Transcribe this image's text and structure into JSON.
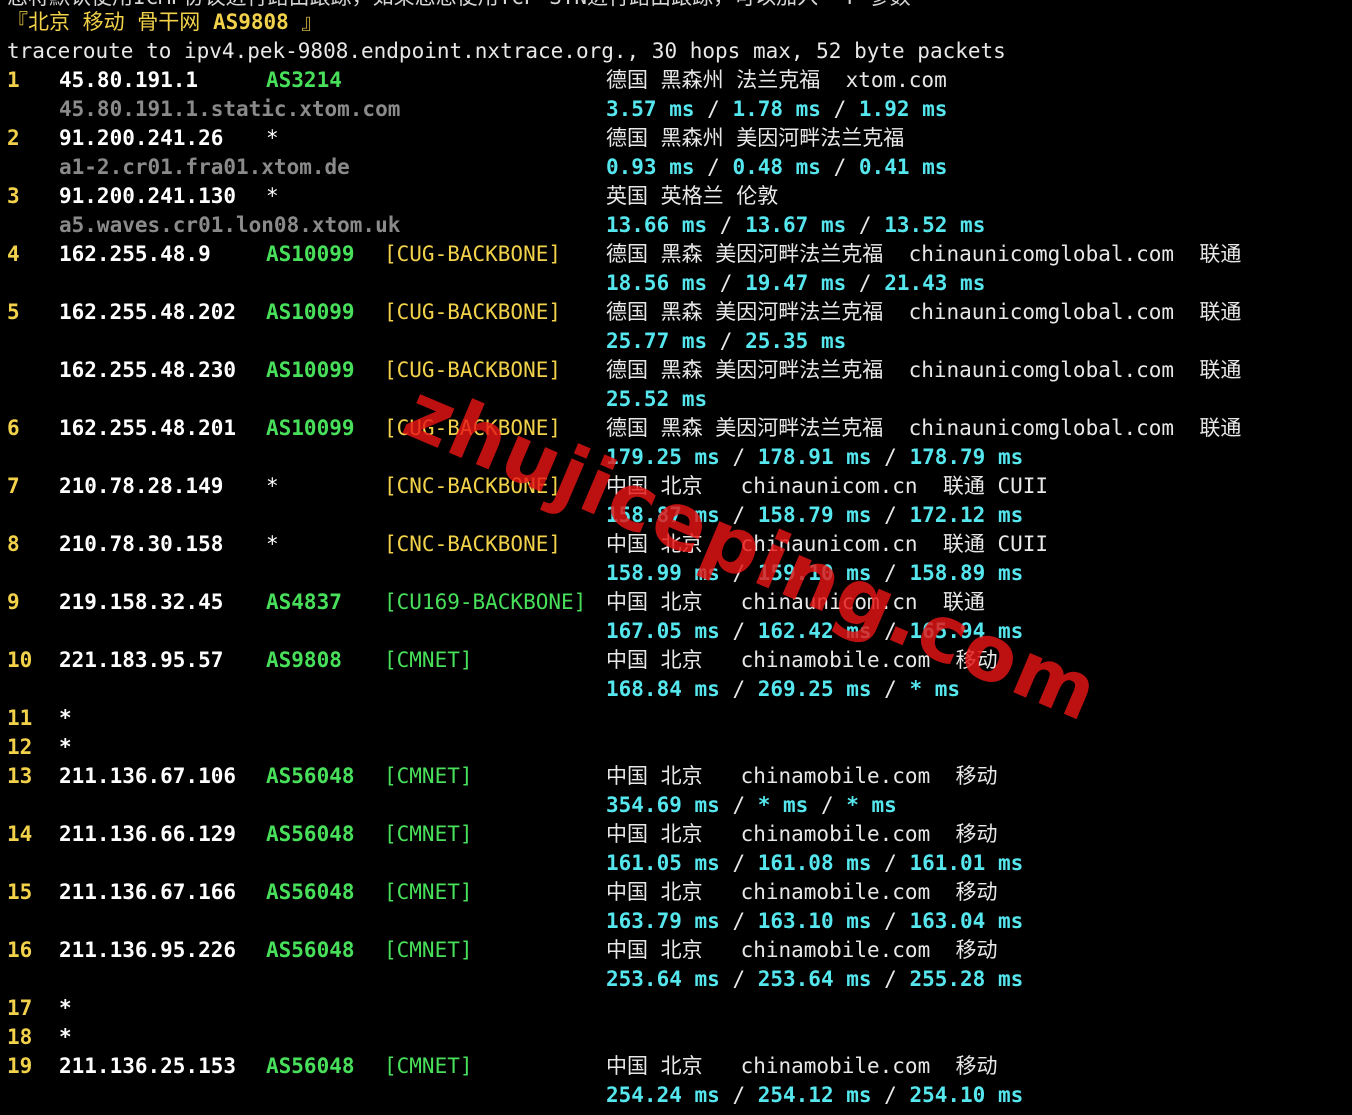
{
  "header": {
    "cut_text": "您将默认使用ICMP协议进行路由跟踪，如果您想使用TCP SYN进行路由跟踪，可以加入 -T 参数",
    "title_prefix": "『北京 移动 骨干网 ",
    "title_as": "AS9808",
    "title_suffix": " 』",
    "trace_line": "traceroute to ipv4.pek-9808.endpoint.nxtrace.org., 30 hops max, 52 byte packets"
  },
  "hops": [
    {
      "num": "1",
      "ip": "45.80.191.1",
      "asn": "AS3214",
      "tag": "",
      "geo": "德国 黑森州 法兰克福  xtom.com",
      "host": "45.80.191.1.static.xtom.com",
      "rtt": [
        "3.57 ms",
        "1.78 ms",
        "1.92 ms"
      ]
    },
    {
      "num": "2",
      "ip": "91.200.241.26",
      "asn": "*",
      "tag": "",
      "geo": "德国 黑森州 美因河畔法兰克福",
      "host": "a1-2.cr01.fra01.xtom.de",
      "rtt": [
        "0.93 ms",
        "0.48 ms",
        "0.41 ms"
      ]
    },
    {
      "num": "3",
      "ip": "91.200.241.130",
      "asn": "*",
      "tag": "",
      "geo": "英国 英格兰 伦敦",
      "host": "a5.waves.cr01.lon08.xtom.uk",
      "rtt": [
        "13.66 ms",
        "13.67 ms",
        "13.52 ms"
      ]
    },
    {
      "num": "4",
      "ip": "162.255.48.9",
      "asn": "AS10099",
      "tag": "[CUG-BACKBONE]",
      "geo": "德国 黑森 美因河畔法兰克福  chinaunicomglobal.com  联通",
      "host": "",
      "rtt": [
        "18.56 ms",
        "19.47 ms",
        "21.43 ms"
      ]
    },
    {
      "num": "5",
      "ip": "162.255.48.202",
      "asn": "AS10099",
      "tag": "[CUG-BACKBONE]",
      "geo": "德国 黑森 美因河畔法兰克福  chinaunicomglobal.com  联通",
      "host": "",
      "rtt": [
        "25.77 ms",
        "25.35 ms"
      ]
    },
    {
      "num": "",
      "ip": "162.255.48.230",
      "asn": "AS10099",
      "tag": "[CUG-BACKBONE]",
      "geo": "德国 黑森 美因河畔法兰克福  chinaunicomglobal.com  联通",
      "host": "",
      "rtt": [
        "25.52 ms"
      ]
    },
    {
      "num": "6",
      "ip": "162.255.48.201",
      "asn": "AS10099",
      "tag": "[CUG-BACKBONE]",
      "geo": "德国 黑森 美因河畔法兰克福  chinaunicomglobal.com  联通",
      "host": "",
      "rtt": [
        "179.25 ms",
        "178.91 ms",
        "178.79 ms"
      ]
    },
    {
      "num": "7",
      "ip": "210.78.28.149",
      "asn": "*",
      "tag": "[CNC-BACKBONE]",
      "geo": "中国 北京   chinaunicom.cn  联通 CUII",
      "host": "",
      "rtt": [
        "158.87 ms",
        "158.79 ms",
        "172.12 ms"
      ]
    },
    {
      "num": "8",
      "ip": "210.78.30.158",
      "asn": "*",
      "tag": "[CNC-BACKBONE]",
      "geo": "中国 北京   chinaunicom.cn  联通 CUII",
      "host": "",
      "rtt": [
        "158.99 ms",
        "159.10 ms",
        "158.89 ms"
      ]
    },
    {
      "num": "9",
      "ip": "219.158.32.45",
      "asn": "AS4837",
      "tag": "[CU169-BACKBONE]",
      "geo": "中国 北京   chinaunicom.cn  联通",
      "host": "",
      "rtt": [
        "167.05 ms",
        "162.42 ms",
        "165.94 ms"
      ]
    },
    {
      "num": "10",
      "ip": "221.183.95.57",
      "asn": "AS9808",
      "tag": "[CMNET]",
      "geo": "中国 北京   chinamobile.com  移动",
      "host": "",
      "rtt": [
        "168.84 ms",
        "269.25 ms",
        "* ms"
      ]
    },
    {
      "num": "11",
      "ip": "*",
      "asn": "",
      "tag": "",
      "geo": "",
      "host": "",
      "rtt": []
    },
    {
      "num": "12",
      "ip": "*",
      "asn": "",
      "tag": "",
      "geo": "",
      "host": "",
      "rtt": []
    },
    {
      "num": "13",
      "ip": "211.136.67.106",
      "asn": "AS56048",
      "tag": "[CMNET]",
      "geo": "中国 北京   chinamobile.com  移动",
      "host": "",
      "rtt": [
        "354.69 ms",
        "* ms",
        "* ms"
      ]
    },
    {
      "num": "14",
      "ip": "211.136.66.129",
      "asn": "AS56048",
      "tag": "[CMNET]",
      "geo": "中国 北京   chinamobile.com  移动",
      "host": "",
      "rtt": [
        "161.05 ms",
        "161.08 ms",
        "161.01 ms"
      ]
    },
    {
      "num": "15",
      "ip": "211.136.67.166",
      "asn": "AS56048",
      "tag": "[CMNET]",
      "geo": "中国 北京   chinamobile.com  移动",
      "host": "",
      "rtt": [
        "163.79 ms",
        "163.10 ms",
        "163.04 ms"
      ]
    },
    {
      "num": "16",
      "ip": "211.136.95.226",
      "asn": "AS56048",
      "tag": "[CMNET]",
      "geo": "中国 北京   chinamobile.com  移动",
      "host": "",
      "rtt": [
        "253.64 ms",
        "253.64 ms",
        "255.28 ms"
      ]
    },
    {
      "num": "17",
      "ip": "*",
      "asn": "",
      "tag": "",
      "geo": "",
      "host": "",
      "rtt": []
    },
    {
      "num": "18",
      "ip": "*",
      "asn": "",
      "tag": "",
      "geo": "",
      "host": "",
      "rtt": []
    },
    {
      "num": "19",
      "ip": "211.136.25.153",
      "asn": "AS56048",
      "tag": "[CMNET]",
      "geo": "中国 北京   chinamobile.com  移动",
      "host": "",
      "rtt": [
        "254.24 ms",
        "254.12 ms",
        "254.10 ms"
      ]
    }
  ],
  "watermark": "zhujiceping.com",
  "colors": {
    "background": "#000000",
    "hop_number": "#f2d24a",
    "ip": "#ffffff",
    "asn": "#48e05a",
    "rtt": "#55e6ee",
    "hostname": "#8a8a8a",
    "watermark": "#e61414"
  }
}
